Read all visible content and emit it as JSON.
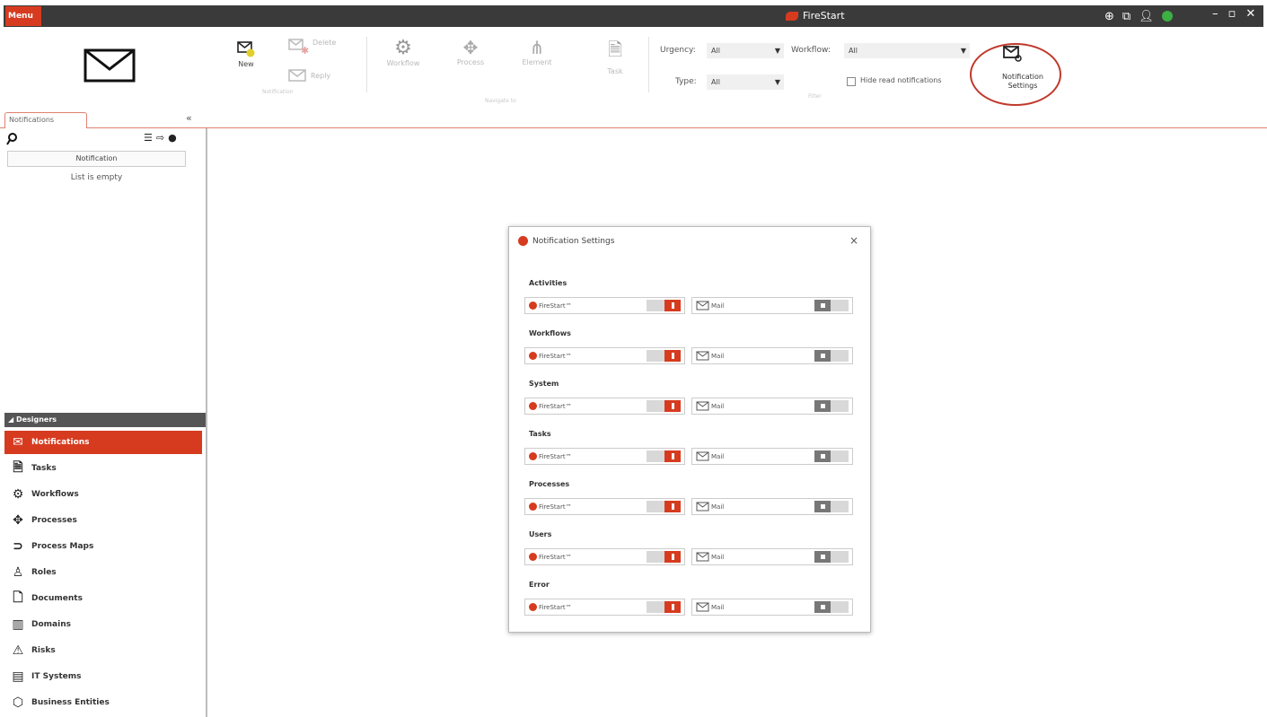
{
  "titlebar": {
    "menu_label": "Menu",
    "app_title": "FireStart"
  },
  "ribbon": {
    "new_label": "New",
    "delete_label": "Delete",
    "reply_label": "Reply",
    "group_notification": "Notification",
    "workflow_label": "Workflow",
    "process_label": "Process",
    "element_label": "Element",
    "task_label": "Task",
    "group_navigate": "Navigate to",
    "urgency_label": "Urgency:",
    "urgency_value": "All",
    "workflow_filter_label": "Workflow:",
    "workflow_filter_value": "All",
    "type_label": "Type:",
    "type_value": "All",
    "hide_read_label": "Hide read notifications",
    "group_filter": "Filter",
    "notification_settings_label": "Notification Settings"
  },
  "left_pane": {
    "tab_label": "Notifications",
    "collapse_glyph": "«",
    "column_header": "Notification",
    "empty_message": "List is empty",
    "designers_header": "◢ Designers",
    "nav_items": [
      {
        "label": "Notifications",
        "icon": "mail-icon"
      },
      {
        "label": "Tasks",
        "icon": "task-icon"
      },
      {
        "label": "Workflows",
        "icon": "gear-icon"
      },
      {
        "label": "Processes",
        "icon": "process-icon"
      },
      {
        "label": "Process Maps",
        "icon": "process-map-icon"
      },
      {
        "label": "Roles",
        "icon": "role-icon"
      },
      {
        "label": "Documents",
        "icon": "document-icon"
      },
      {
        "label": "Domains",
        "icon": "domain-icon"
      },
      {
        "label": "Risks",
        "icon": "risk-icon"
      },
      {
        "label": "IT Systems",
        "icon": "it-system-icon"
      },
      {
        "label": "Business Entities",
        "icon": "business-entity-icon"
      }
    ]
  },
  "dialog": {
    "title": "Notification Settings",
    "close_glyph": "×",
    "firestart_label": "FireStart™",
    "mail_label": "Mail",
    "sections": [
      {
        "label": "Activities",
        "firestart_on": true,
        "mail_on": false
      },
      {
        "label": "Workflows",
        "firestart_on": true,
        "mail_on": false
      },
      {
        "label": "System",
        "firestart_on": true,
        "mail_on": false
      },
      {
        "label": "Tasks",
        "firestart_on": true,
        "mail_on": false
      },
      {
        "label": "Processes",
        "firestart_on": true,
        "mail_on": false
      },
      {
        "label": "Users",
        "firestart_on": true,
        "mail_on": false
      },
      {
        "label": "Error",
        "firestart_on": true,
        "mail_on": false
      }
    ]
  },
  "colors": {
    "accent": "#d63b1f",
    "titlebar": "#3a3a3a",
    "highlight_circle": "#c0392b"
  }
}
